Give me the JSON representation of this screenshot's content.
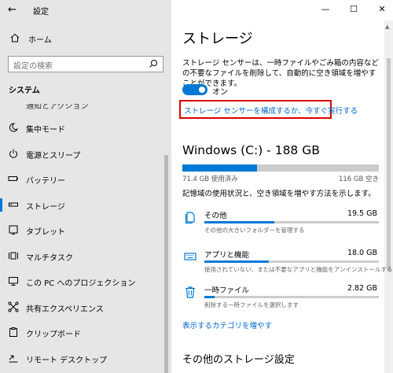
{
  "window": {
    "title": "設定"
  },
  "sidebar": {
    "home_label": "ホーム",
    "search_placeholder": "設定の検索",
    "section_label": "システム",
    "partial_item_label": "通知とアクション",
    "items": [
      {
        "label": "集中モード",
        "icon": "moon-icon"
      },
      {
        "label": "電源とスリープ",
        "icon": "power-icon"
      },
      {
        "label": "バッテリー",
        "icon": "battery-icon"
      },
      {
        "label": "ストレージ",
        "icon": "storage-icon",
        "selected": true
      },
      {
        "label": "タブレット",
        "icon": "tablet-icon"
      },
      {
        "label": "マルチタスク",
        "icon": "multitask-icon"
      },
      {
        "label": "この PC へのプロジェクション",
        "icon": "projection-icon"
      },
      {
        "label": "共有エクスペリエンス",
        "icon": "shared-icon"
      },
      {
        "label": "クリップボード",
        "icon": "clipboard-icon"
      },
      {
        "label": "リモート デスクトップ",
        "icon": "remote-icon"
      }
    ]
  },
  "main": {
    "page_title": "ストレージ",
    "description": "ストレージ センサーは、一時ファイルやごみ箱の内容などの不要なファイルを削除して、自動的に空き領域を増やすことができます。",
    "toggle_label": "オン",
    "configure_link": "ストレージ センサーを構成するか、今すぐ実行する",
    "drive": {
      "title": "Windows (C:) - 188 GB",
      "used_label": "71.4 GB 使用済み",
      "free_label": "116 GB 空き",
      "used_fraction": 0.38
    },
    "usage_desc": "記憶域の使用状況と、空き領域を増やす方法を示します。",
    "categories": [
      {
        "name": "その他",
        "size": "19.5 GB",
        "hint": "その他の大きいフォルダーを管理する",
        "fraction": 0.4,
        "icon": "document-icon"
      },
      {
        "name": "アプリと機能",
        "size": "18.0 GB",
        "hint": "使用されていない、または不要なアプリと機能をアンインストールする",
        "fraction": 0.37,
        "icon": "keyboard-icon"
      },
      {
        "name": "一時ファイル",
        "size": "2.82 GB",
        "hint": "削除する一時ファイルを選択します",
        "fraction": 0.06,
        "icon": "trash-icon"
      }
    ],
    "more_categories_link": "表示するカテゴリを増やす",
    "other_settings_title": "その他のストレージ設定"
  },
  "colors": {
    "accent": "#0078d7",
    "highlight_border": "#e00000",
    "link": "#0066cc",
    "sidebar_bg": "#e6e6e6"
  }
}
